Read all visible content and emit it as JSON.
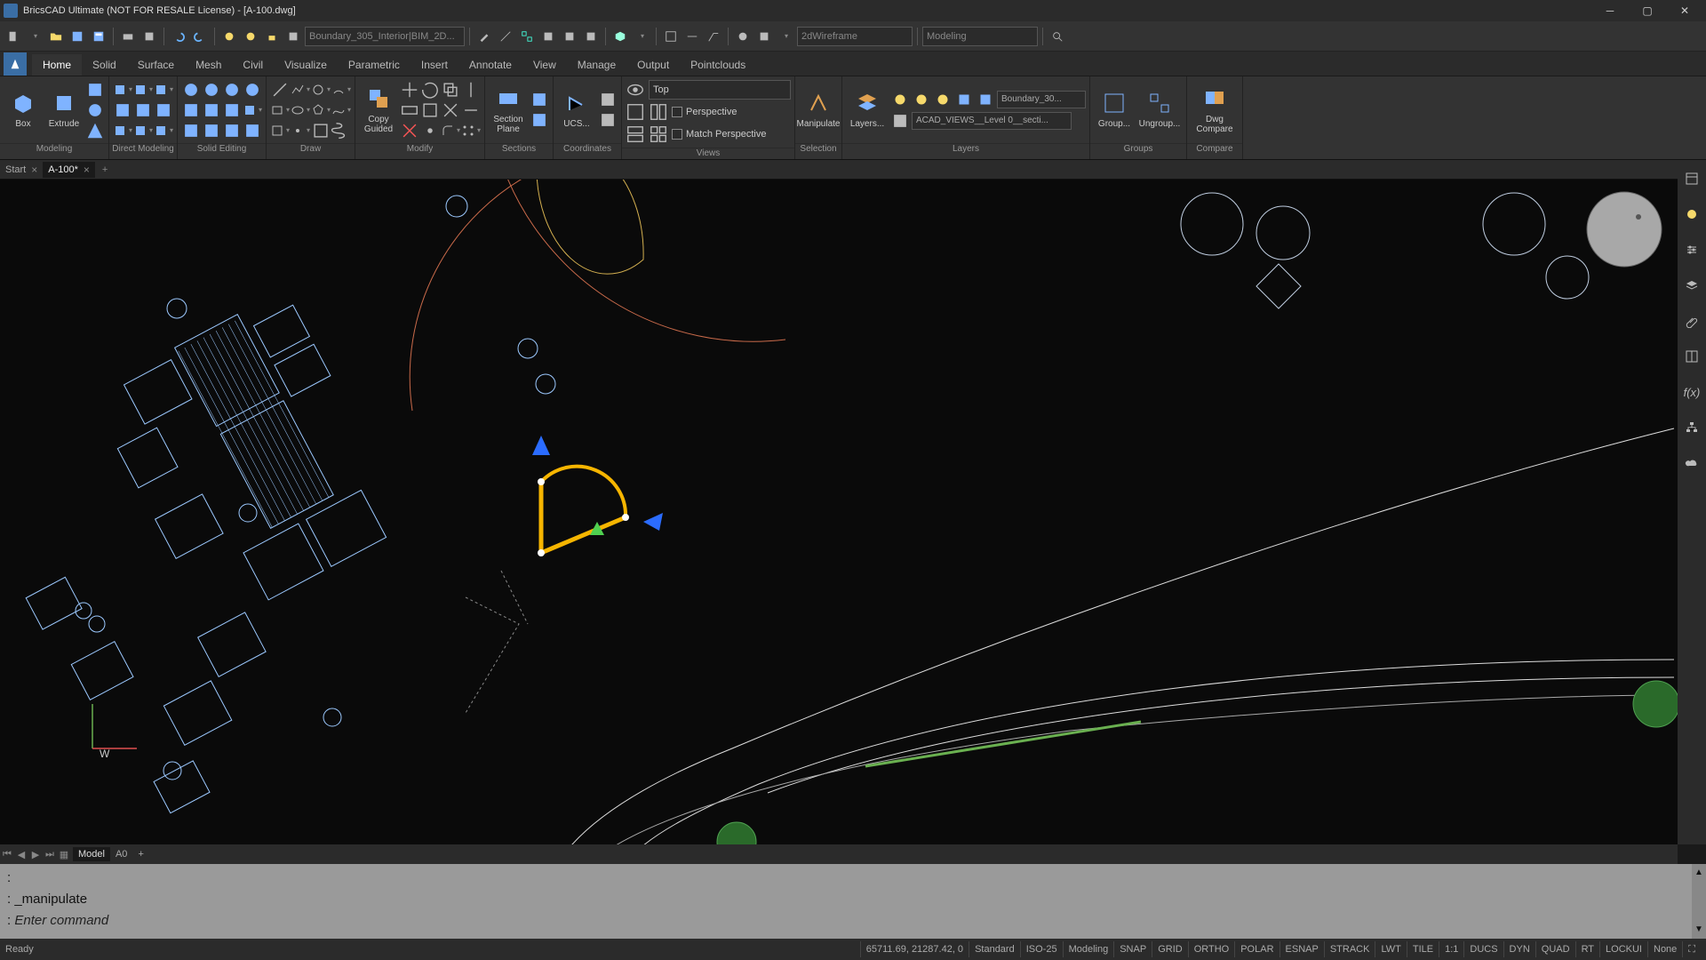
{
  "app": {
    "title": "BricsCAD Ultimate (NOT FOR RESALE License) - [A-100.dwg]"
  },
  "qat": {
    "layer_dd": "Boundary_305_Interior|BIM_2D...",
    "visual_style": "2dWireframe",
    "workspace": "Modeling"
  },
  "ribbon": {
    "tabs": [
      "Home",
      "Solid",
      "Surface",
      "Mesh",
      "Civil",
      "Visualize",
      "Parametric",
      "Insert",
      "Annotate",
      "View",
      "Manage",
      "Output",
      "Pointclouds"
    ],
    "active_tab_index": 0,
    "panels": {
      "modeling": {
        "label": "Modeling",
        "box": "Box",
        "extrude": "Extrude"
      },
      "direct_modeling": {
        "label": "Direct Modeling"
      },
      "solid_editing": {
        "label": "Solid Editing"
      },
      "draw": {
        "label": "Draw"
      },
      "modify": {
        "label": "Modify",
        "copy_guided": "Copy\nGuided"
      },
      "sections": {
        "label": "Sections",
        "section_plane": "Section\nPlane"
      },
      "coordinates": {
        "label": "Coordinates",
        "ucs": "UCS..."
      },
      "views": {
        "label": "Views",
        "selected": "Top",
        "perspective": "Perspective",
        "match_perspective": "Match Perspective"
      },
      "selection": {
        "label": "Selection",
        "manipulate": "Manipulate"
      },
      "layers": {
        "label": "Layers",
        "layers_btn": "Layers...",
        "filter1": "Boundary_30...",
        "filter2": "ACAD_VIEWS__Level 0__secti..."
      },
      "groups": {
        "label": "Groups",
        "group": "Group...",
        "ungroup": "Ungroup..."
      },
      "compare": {
        "label": "Compare",
        "dwg_compare": "Dwg\nCompare"
      }
    }
  },
  "doctabs": {
    "tabs": [
      {
        "name": "Start",
        "closable": true
      },
      {
        "name": "A-100*",
        "closable": true
      }
    ],
    "active_index": 1
  },
  "modeltabs": {
    "model": "Model",
    "layout": "A0"
  },
  "command": {
    "history1": ":",
    "history2": ": _manipulate",
    "prompt": ": ",
    "placeholder": "Enter command"
  },
  "status": {
    "ready": "Ready",
    "coords": "65711.69, 21287.42, 0",
    "segments": [
      "Standard",
      "ISO-25",
      "Modeling",
      "SNAP",
      "GRID",
      "ORTHO",
      "POLAR",
      "ESNAP",
      "STRACK",
      "LWT",
      "TILE",
      "1:1",
      "DUCS",
      "DYN",
      "QUAD",
      "RT",
      "LOCKUI",
      "None"
    ]
  }
}
